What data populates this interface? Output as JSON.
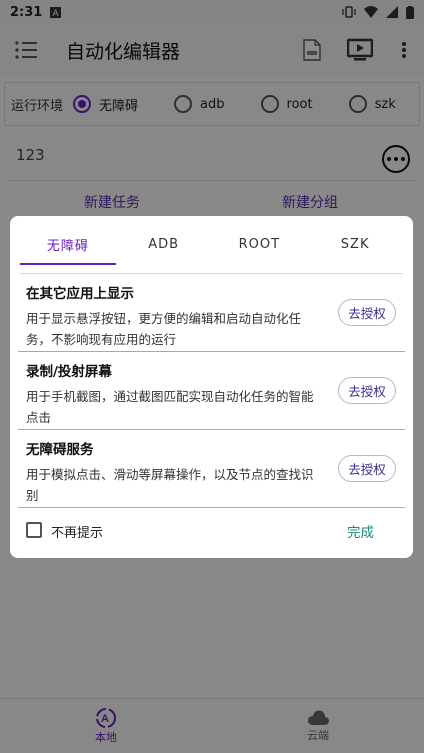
{
  "status_bar": {
    "time": "2:31"
  },
  "app_bar": {
    "title": "自动化编辑器"
  },
  "env": {
    "label": "运行环境",
    "options": [
      "无障碍",
      "adb",
      "root",
      "szk"
    ],
    "selected": "无障碍"
  },
  "task": {
    "name": "123"
  },
  "actions": {
    "new_task": "新建任务",
    "new_group": "新建分组"
  },
  "dialog": {
    "tabs": [
      "无障碍",
      "ADB",
      "ROOT",
      "SZK"
    ],
    "active_tab": "无障碍",
    "permissions": [
      {
        "title": "在其它应用上显示",
        "desc": "用于显示悬浮按钮，更方便的编辑和启动自动化任务，不影响现有应用的运行",
        "button": "去授权"
      },
      {
        "title": "录制/投射屏幕",
        "desc": "用于手机截图，通过截图匹配实现自动化任务的智能点击",
        "button": "去授权"
      },
      {
        "title": "无障碍服务",
        "desc": "用于模拟点击、滑动等屏幕操作，以及节点的查找识别",
        "button": "去授权"
      }
    ],
    "dont_remind": "不再提示",
    "done": "完成"
  },
  "bottom_nav": [
    {
      "label": "本地",
      "icon": "local-auto-icon",
      "active": true
    },
    {
      "label": "云端",
      "icon": "cloud-icon",
      "active": false
    }
  ],
  "colors": {
    "accent": "#6a1fbf",
    "done": "#1b8a7a"
  }
}
